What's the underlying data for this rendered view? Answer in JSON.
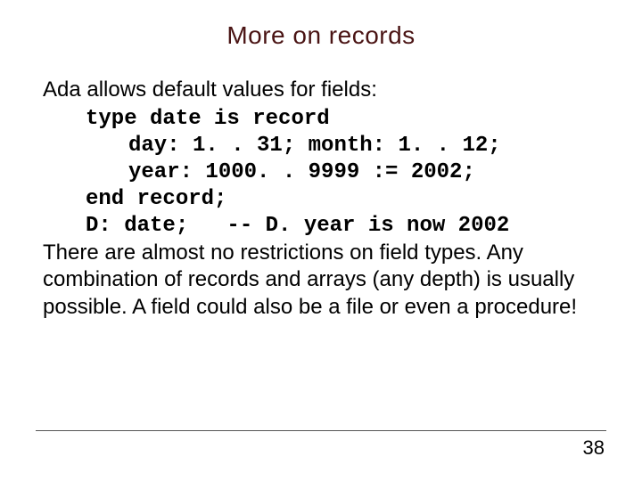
{
  "title": "More  on records",
  "para1": "Ada allows default values for fields:",
  "code": {
    "l1": "type date is record",
    "l2": "day: 1. . 31; month: 1. . 12;",
    "l3": "year: 1000. . 9999 := 2002;",
    "l4": "end record;",
    "l5": "D: date;   -- D. year is now 2002"
  },
  "para2": "There are almost no restrictions on field types. Any combination of records and arrays (any depth) is usually possible. A field could also be a file or even a procedure!",
  "pagenum": "38"
}
